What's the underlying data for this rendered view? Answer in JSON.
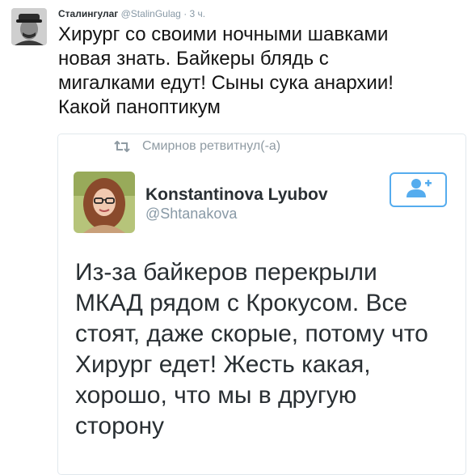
{
  "tweet": {
    "author_name": "Сталингулаг",
    "author_handle": "@StalinGulag",
    "separator": "·",
    "time": "3 ч.",
    "text": "Хирург со своими ночными шавками\nновая знать. Байкеры блядь с\nмигалками едут! Сыны сука анархии!\nКакой паноптикум"
  },
  "quoted": {
    "retweet_label": "Смирнов ретвитнул(-а)",
    "author_name": "Konstantinova Lyubov",
    "author_handle": "@Shtanakova",
    "text": "Из-за байкеров перекрыли\nМКАД рядом с Крокусом. Все\nстоят, даже скорые, потому что\nХирург едет! Жесть какая,\nхорошо, что мы в другую\nсторону"
  },
  "colors": {
    "accent": "#55acee",
    "muted": "#8899a6",
    "text": "#141414"
  },
  "icons": {
    "retweet": "retweet-icon",
    "follow": "follow-user-icon"
  }
}
